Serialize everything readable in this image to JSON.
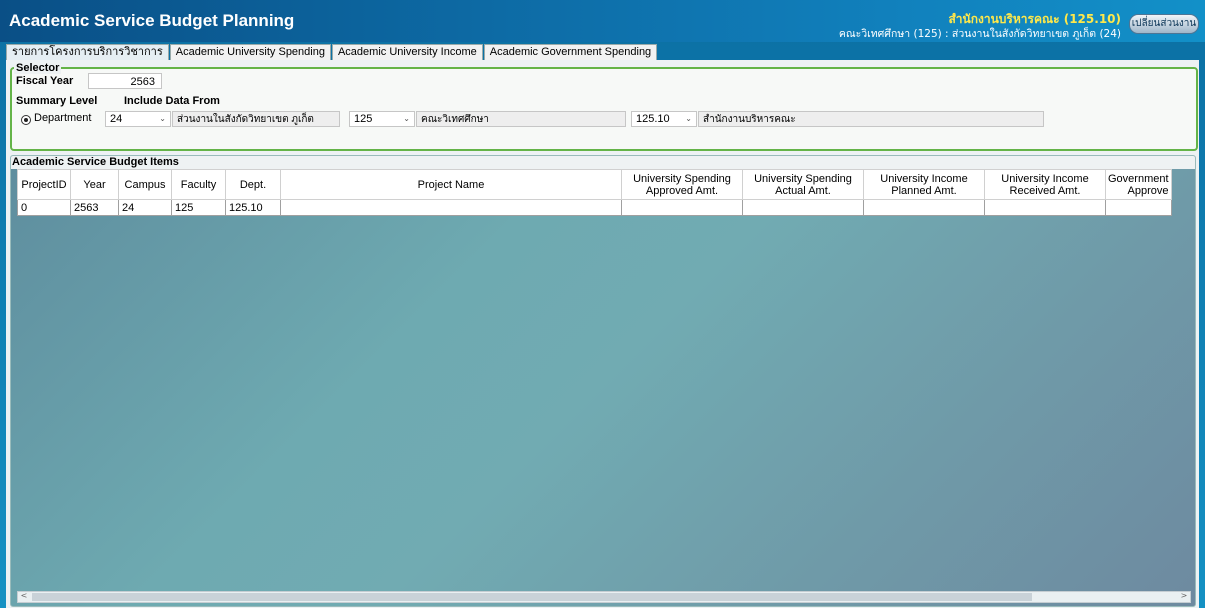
{
  "header": {
    "title": "Academic Service Budget Planning",
    "unit": "สำนักงานบริหารคณะ (125.10)",
    "sub": "คณะวิเทศศึกษา (125) : ส่วนงานในสังกัดวิทยาเขต ภูเก็ต (24)",
    "switch_label": "เปลี่ยนส่วนงาน"
  },
  "tabs": [
    {
      "label": "รายการโครงการบริการวิชาการ"
    },
    {
      "label": "Academic University Spending"
    },
    {
      "label": "Academic University Income"
    },
    {
      "label": "Academic Government Spending"
    }
  ],
  "selector": {
    "legend": "Selector",
    "fiscal_year_label": "Fiscal Year",
    "fiscal_year_value": "2563",
    "summary_level_label": "Summary Level",
    "include_label": "Include Data From",
    "radio_label": "Department",
    "campus_code": "24",
    "campus_name": "ส่วนงานในสังกัดวิทยาเขต ภูเก็ต",
    "faculty_code": "125",
    "faculty_name": "คณะวิเทศศึกษา",
    "dept_code": "125.10",
    "dept_name": "สำนักงานบริหารคณะ"
  },
  "items": {
    "legend": "Academic Service Budget Items",
    "columns": [
      {
        "label": "ProjectID"
      },
      {
        "label": "Year"
      },
      {
        "label": "Campus"
      },
      {
        "label": "Faculty"
      },
      {
        "label": "Dept."
      },
      {
        "label": "Project Name"
      },
      {
        "line1": "University Spending",
        "line2": "Approved Amt."
      },
      {
        "line1": "University Spending",
        "line2": "Actual Amt."
      },
      {
        "line1": "University Income",
        "line2": "Planned Amt."
      },
      {
        "line1": "University Income",
        "line2": "Received Amt."
      },
      {
        "line1": "Government",
        "line2": "Approve"
      }
    ],
    "rows": [
      [
        "0",
        "2563",
        "24",
        "125",
        "125.10",
        "",
        "",
        "",
        "",
        "",
        ""
      ]
    ]
  },
  "colors": {
    "header": "#0d6aa4",
    "selector_border": "#64b448",
    "highlight_text": "#ffe84a"
  },
  "icons": [
    "chevron-down-icon",
    "radio-selected-icon",
    "scroll-left-icon",
    "scroll-right-icon"
  ]
}
